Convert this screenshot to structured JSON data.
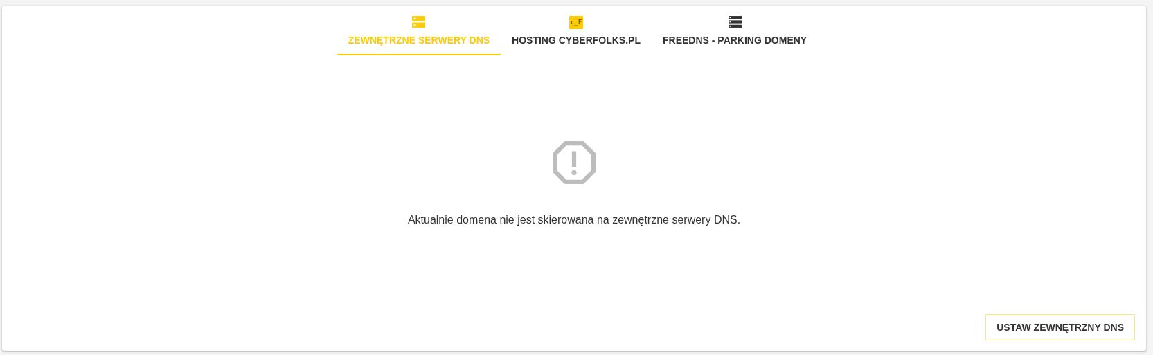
{
  "tabs": [
    {
      "label": "ZEWNĘTRZNE SERWERY DNS",
      "selected": true,
      "kind": "dns"
    },
    {
      "label": "HOSTING CYBERFOLKS.PL",
      "selected": false,
      "kind": "logo",
      "logo_text": "c_F"
    },
    {
      "label": "FREEDNS - PARKING DOMENY",
      "selected": false,
      "kind": "list"
    }
  ],
  "message": "Aktualnie domena nie jest skierowana na zewnętrzne serwery DNS.",
  "button": "USTAW ZEWNĘTRZNY DNS"
}
